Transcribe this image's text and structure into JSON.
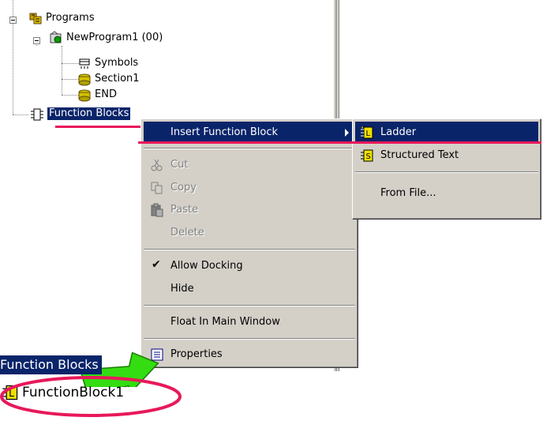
{
  "tree": {
    "programs_label": "Programs",
    "program_label": "NewProgram1 (00)",
    "symbols_label": "Symbols",
    "section_label": "Section1",
    "end_label": "END",
    "function_blocks_label": "Function Blocks"
  },
  "context_menu": {
    "insert_function_block": "Insert Function Block",
    "cut": "Cut",
    "copy": "Copy",
    "paste": "Paste",
    "delete": "Delete",
    "allow_docking": "Allow Docking",
    "hide": "Hide",
    "float_in_main_window": "Float In Main Window",
    "properties": "Properties"
  },
  "submenu": {
    "ladder": "Ladder",
    "structured_text": "Structured Text",
    "from_file": "From File..."
  },
  "result": {
    "function_blocks_label": "Function Blocks",
    "function_block_item": "FunctionBlock1"
  },
  "colors": {
    "highlight": "#0a246a",
    "annotation": "#e8185a",
    "arrow": "#33dd11"
  },
  "icons": [
    "programs-icon",
    "program-icon",
    "symbols-icon",
    "section-icon",
    "end-icon",
    "function-blocks-icon",
    "ladder-icon",
    "structured-text-icon",
    "cut-icon",
    "copy-icon",
    "paste-icon",
    "properties-icon",
    "function-block-icon"
  ]
}
